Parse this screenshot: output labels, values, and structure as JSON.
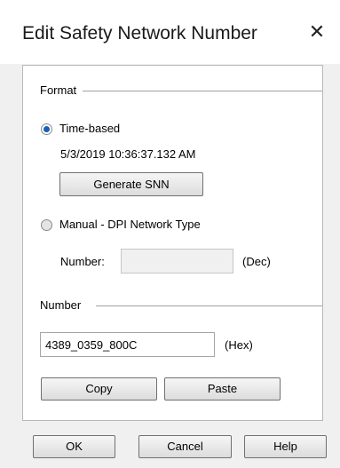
{
  "dialog": {
    "title": "Edit Safety Network Number",
    "close_icon": "close-icon"
  },
  "format_group": {
    "label": "Format",
    "time_based": {
      "label": "Time-based",
      "checked": true,
      "timestamp": "5/3/2019 10:36:37.132 AM",
      "generate_button": "Generate SNN"
    },
    "manual": {
      "label": "Manual - DPI Network Type",
      "checked": false,
      "number_label": "Number:",
      "number_value": "",
      "unit": "(Dec)"
    }
  },
  "number_group": {
    "label": "Number",
    "value": "4389_0359_800C",
    "unit": "(Hex)",
    "copy_button": "Copy",
    "paste_button": "Paste"
  },
  "footer": {
    "ok_button": "OK",
    "cancel_button": "Cancel",
    "help_button": "Help"
  }
}
